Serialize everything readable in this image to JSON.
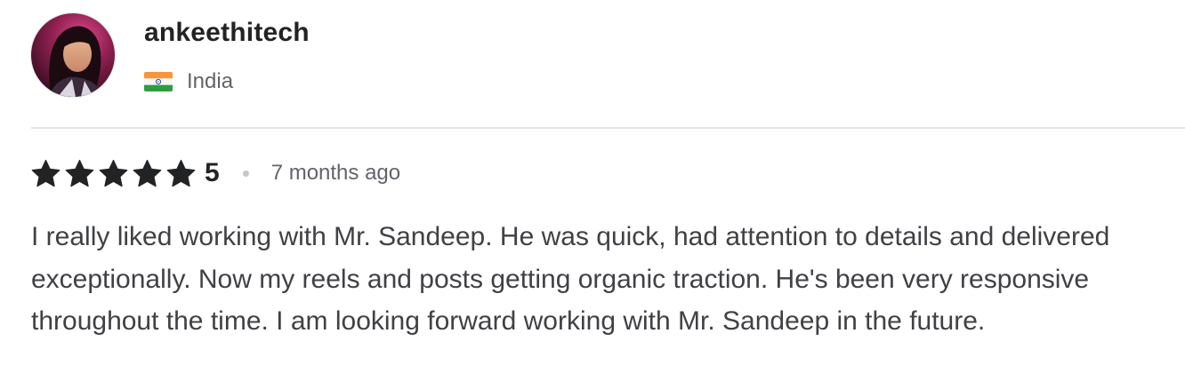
{
  "reviewer": {
    "username": "ankeethitech",
    "country": "India",
    "flag_icon": "india-flag-icon",
    "avatar_icon": "user-avatar"
  },
  "rating": {
    "stars": 5,
    "max_stars": 5,
    "value": "5",
    "star_icon": "star-icon",
    "star_color": "#222325"
  },
  "time_ago": "7 months ago",
  "review_text": "I really liked working with Mr. Sandeep. He was quick, had attention to details and delivered exceptionally. Now my reels and posts getting organic traction. He's been very responsive throughout the time. I am looking forward working with Mr. Sandeep in the future.",
  "colors": {
    "text_primary": "#222325",
    "text_secondary": "#62646a",
    "text_body": "#404145",
    "divider": "#e4e5e7"
  }
}
